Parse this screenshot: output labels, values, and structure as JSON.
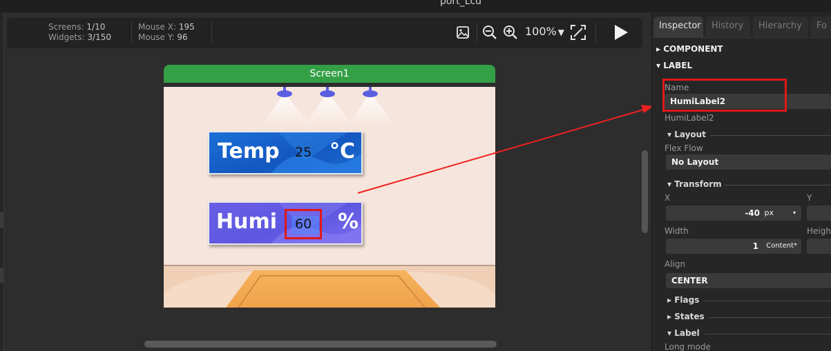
{
  "window": {
    "title": "port_Lcd"
  },
  "toolbar": {
    "screens_label": "Screens:",
    "screens_value": "1/10",
    "widgets_label": "Widgets:",
    "widgets_value": "3/150",
    "mouse_x_label": "Mouse X:",
    "mouse_x_value": "195",
    "mouse_y_label": "Mouse Y:",
    "mouse_y_value": "96",
    "zoom": "100%",
    "icons": [
      "image-icon",
      "zoom-out-icon",
      "zoom-in-icon",
      "dropdown-arrow-icon",
      "fit-screen-icon",
      "play-icon"
    ]
  },
  "screen": {
    "title": "Screen1",
    "temp_panel": {
      "label": "Temp",
      "value": "25",
      "unit": "°C"
    },
    "humi_panel": {
      "label": "Humi",
      "value": "60",
      "unit": "%"
    }
  },
  "inspector": {
    "tabs": [
      "Inspector",
      "History",
      "Hierarchy",
      "Fo"
    ],
    "sections": {
      "component": "COMPONENT",
      "label": "LABEL"
    },
    "name_label": "Name",
    "name_value": "HumiLabel2",
    "name_hint": "HumiLabel2",
    "layout_head": "Layout",
    "flex_flow_label": "Flex Flow",
    "flex_flow_value": "No Layout",
    "transform_head": "Transform",
    "x_label": "X",
    "x_value": "-40",
    "x_unit": "px",
    "y_label": "Y",
    "width_label": "Width",
    "width_value": "1",
    "width_unit": "Content*",
    "height_label": "Height",
    "align_label": "Align",
    "align_value": "CENTER",
    "flags_head": "Flags",
    "states_head": "States",
    "label_head": "Label",
    "long_mode_label": "Long mode"
  },
  "colors": {
    "screen_title_bar": "#34a046",
    "temp_panel": "#1a6ad0",
    "humi_panel": "#7060e0",
    "highlight": "#e01818"
  }
}
